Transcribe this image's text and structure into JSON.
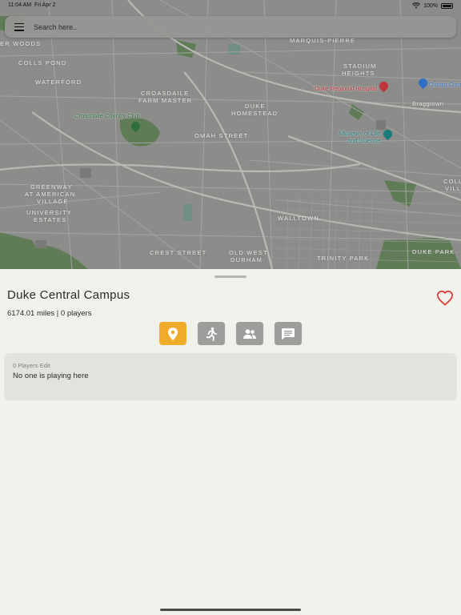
{
  "status_bar": {
    "time": "11:04 AM",
    "date": "Fri Apr 2",
    "battery": "100%"
  },
  "search": {
    "placeholder": "Search here.."
  },
  "map": {
    "labels": [
      {
        "id": "er-woods",
        "text": "ER WOODS"
      },
      {
        "id": "colls-pond",
        "text": "COLLS POND"
      },
      {
        "id": "waterford",
        "text": "WATERFORD"
      },
      {
        "id": "marquis-pierre",
        "text": "MARQUIS-PIERRE"
      },
      {
        "id": "stadium-heights-1",
        "text": "STADIUM"
      },
      {
        "id": "stadium-heights-2",
        "text": "HEIGHTS"
      },
      {
        "id": "croasdaile-farm-1",
        "text": "CROASDAILE"
      },
      {
        "id": "croasdaile-farm-2",
        "text": "FARM MASTER"
      },
      {
        "id": "duke-homestead-1",
        "text": "DUKE"
      },
      {
        "id": "duke-homestead-2",
        "text": "HOMESTEAD"
      },
      {
        "id": "omah-street",
        "text": "OMAH STREET"
      },
      {
        "id": "braggtown",
        "text": "Braggtown"
      },
      {
        "id": "greenway-1",
        "text": "GREENWAY"
      },
      {
        "id": "greenway-2",
        "text": "AT AMERICAN"
      },
      {
        "id": "greenway-3",
        "text": "VILLAGE"
      },
      {
        "id": "university-1",
        "text": "UNIVERSITY"
      },
      {
        "id": "university-2",
        "text": "ESTATES"
      },
      {
        "id": "walltown",
        "text": "WALLTOWN"
      },
      {
        "id": "crest-street",
        "text": "CREST STREET"
      },
      {
        "id": "old-west-1",
        "text": "OLD WEST"
      },
      {
        "id": "old-west-2",
        "text": "DURHAM"
      },
      {
        "id": "trinity-park",
        "text": "TRINITY PARK"
      },
      {
        "id": "duke-park",
        "text": "DUKE PARK"
      },
      {
        "id": "coll-vill-1",
        "text": "COLL"
      },
      {
        "id": "coll-vill-2",
        "text": "VILL"
      }
    ],
    "pois": [
      {
        "id": "croasdaile-cc",
        "text": "Croasdaile Country Club",
        "color": "#2f6e3c"
      },
      {
        "id": "duke-hospital",
        "text": "Duke Regional Hospital",
        "color": "#c0353a"
      },
      {
        "id": "oxford-com",
        "text": "Oxford Com",
        "color": "#2f6fc8"
      },
      {
        "id": "museum-1",
        "text": "Museum of Life",
        "color": "#1b7a7a"
      },
      {
        "id": "museum-2",
        "text": "and Science",
        "color": "#1b7a7a"
      }
    ]
  },
  "sheet": {
    "title": "Duke Central Campus",
    "distance": "6174.01 miles",
    "separator": "|",
    "players_count": "0 players",
    "tabs": [
      {
        "id": "location",
        "icon": "location-pin-icon",
        "active": true
      },
      {
        "id": "activity",
        "icon": "running-person-icon",
        "active": false
      },
      {
        "id": "people",
        "icon": "people-icon",
        "active": false
      },
      {
        "id": "chat",
        "icon": "chat-icon",
        "active": false
      }
    ],
    "card": {
      "players_label": "0 Players",
      "dot": "·",
      "edit_label": "Edit",
      "empty_text": "No one is playing here"
    }
  },
  "colors": {
    "accent": "#f0ab2a",
    "heart": "#d9423d",
    "tab_inactive": "#9d9d9b"
  }
}
